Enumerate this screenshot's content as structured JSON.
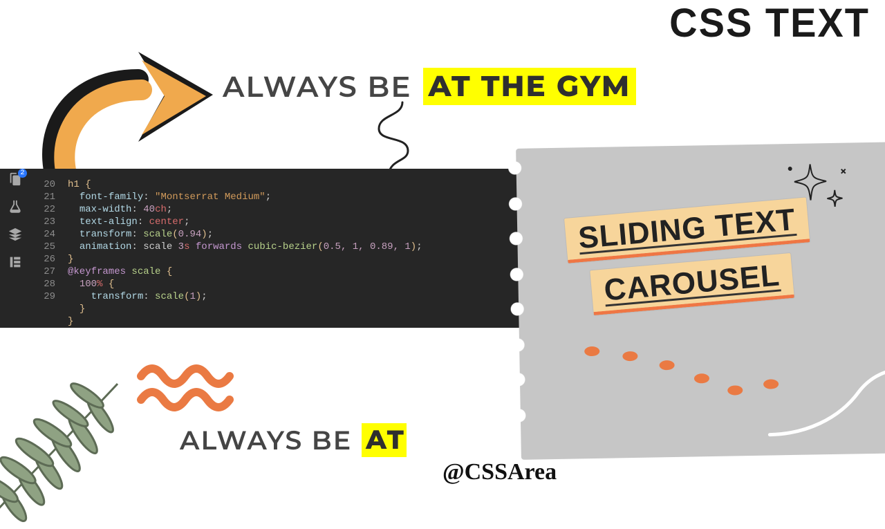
{
  "banner": {
    "css_text": "CSS TEXT"
  },
  "headline": {
    "static": "ALWAYS BE",
    "dynamic": "AT THE GYM"
  },
  "headline2": {
    "static": "ALWAYS BE",
    "dynamic": "AT"
  },
  "editor": {
    "line_numbers": [
      "",
      "",
      "20",
      "21",
      "22",
      "23",
      "24",
      "25",
      "26",
      "27",
      "28",
      "29"
    ],
    "code": {
      "l0_sel": "h1 ",
      "l0_brace": "{",
      "l1_prop": "font-family",
      "l1_val": "\"Montserrat Medium\"",
      "l2_prop": "max-width",
      "l2_num": "40",
      "l2_unit": "ch",
      "l3_prop": "text-align",
      "l3_val": "center",
      "l4_prop": "transform",
      "l4_fn": "scale",
      "l4_arg": "0.94",
      "l5_prop": "animation",
      "l5_name": "scale",
      "l5_dur": "3",
      "l5_durunit": "s",
      "l5_fill": "forwards",
      "l5_fn": "cubic-bezier",
      "l5_args": "0.5, 1, 0.89, 1",
      "l6_brace": "}",
      "l7_at": "@keyframes",
      "l7_name": "scale",
      "l7_brace": "{",
      "l8_pct": "100",
      "l8_unit": "%",
      "l8_brace": "{",
      "l9_prop": "transform",
      "l9_fn": "scale",
      "l9_arg": "1",
      "l10_brace": "}",
      "l11_brace": "}"
    }
  },
  "paper": {
    "line1": "SLIDING TEXT",
    "line2": "CAROUSEL"
  },
  "handle": "@CSSArea",
  "colors": {
    "highlight": "#ffff00",
    "arrow": "#f0a94d",
    "paper_label_bg": "#f7d59b",
    "paper_label_underline": "#ef7644"
  }
}
